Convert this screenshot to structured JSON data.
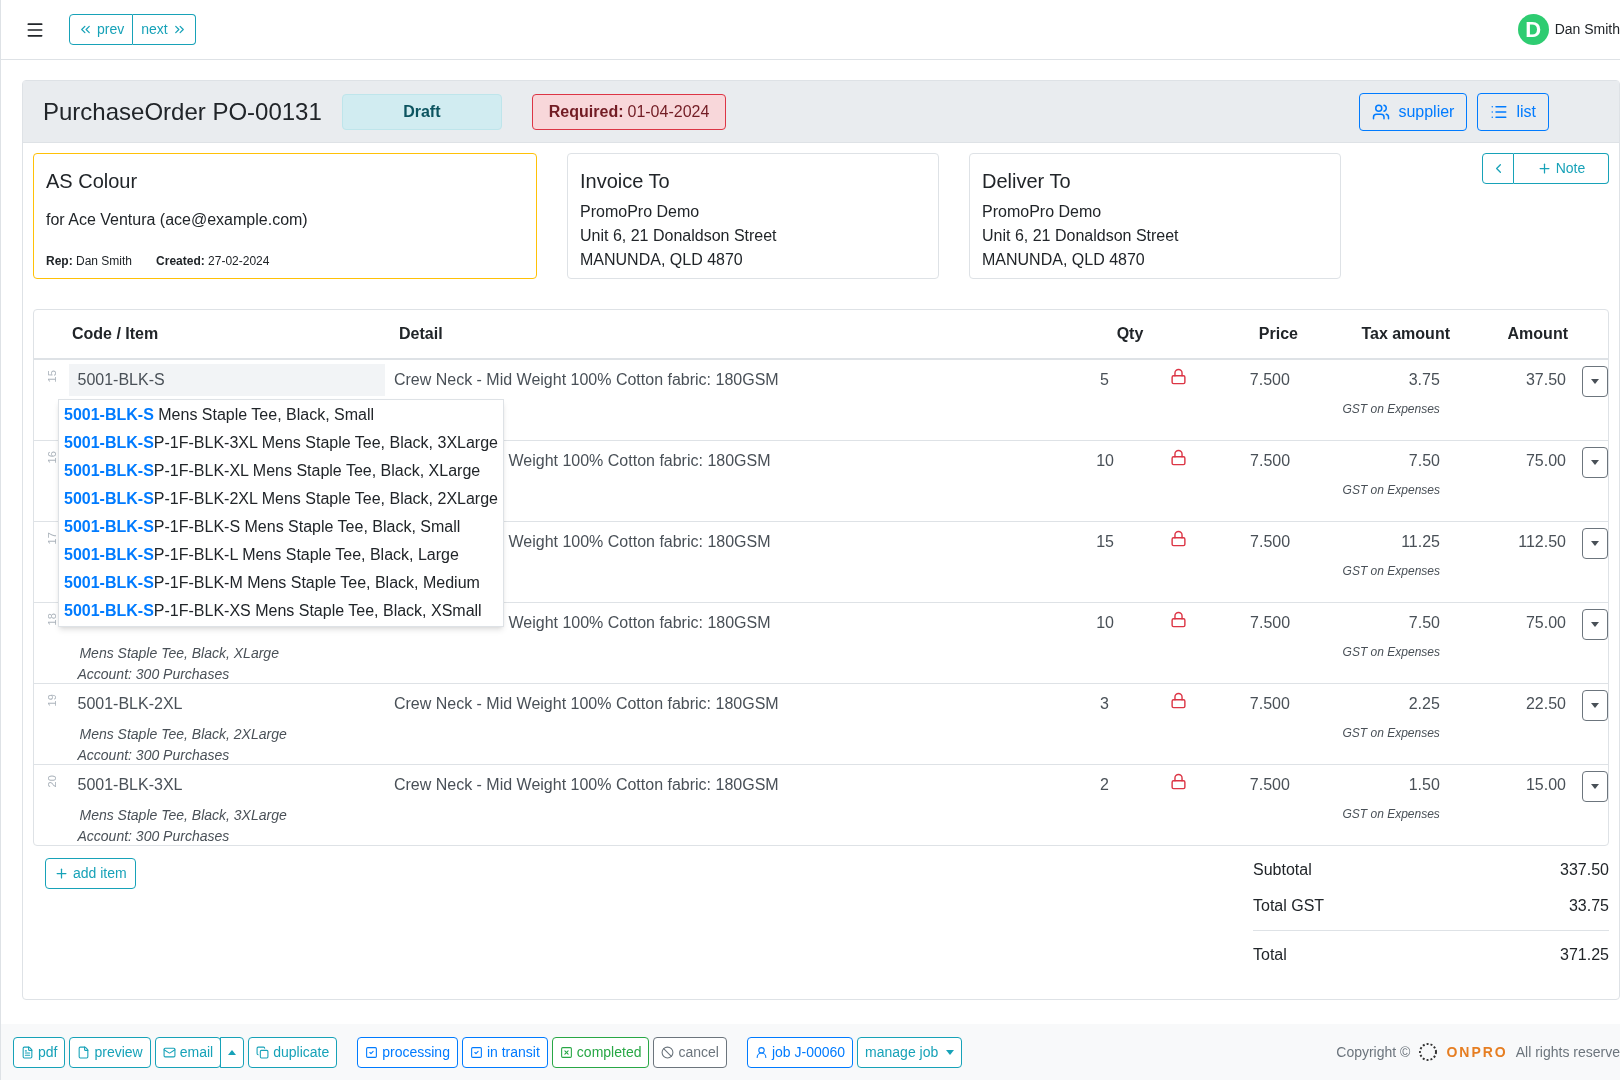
{
  "nav": {
    "prev": "prev",
    "next": "next",
    "user": {
      "initial": "D",
      "name": "Dan Smith"
    }
  },
  "order": {
    "title": "PurchaseOrder PO-00131",
    "status": "Draft",
    "required_label": "Required:",
    "required_date": "01-04-2024",
    "supplier_button": "supplier",
    "list_button": "list",
    "note_button": "Note"
  },
  "supplier": {
    "name": "AS Colour",
    "for": "for Ace Ventura (ace@example.com)",
    "rep_label": "Rep:",
    "rep": "Dan Smith",
    "created_label": "Created:",
    "created": "27-02-2024"
  },
  "addresses": [
    {
      "title": "Invoice To",
      "lines": [
        "PromoPro Demo",
        "Unit 6, 21 Donaldson Street",
        "MANUNDA, QLD 4870"
      ]
    },
    {
      "title": "Deliver To",
      "lines": [
        "PromoPro Demo",
        "Unit 6, 21 Donaldson Street",
        "MANUNDA, QLD 4870"
      ]
    }
  ],
  "table": {
    "columns": [
      "Code / Item",
      "Detail",
      "Qty",
      "Price",
      "Tax amount",
      "Amount"
    ],
    "rows": [
      {
        "line": "15",
        "code": "5001-BLK-S",
        "editing": true,
        "detail": "Crew Neck - Mid Weight 100% Cotton fabric: 180GSM",
        "qty": "5",
        "locked": true,
        "price": "7.500",
        "tax": "3.75",
        "tax_type": "GST on Expenses",
        "amount": "37.50"
      },
      {
        "line": "16",
        "covered": true,
        "detail": "Weight 100% Cotton fabric: 180GSM",
        "qty": "10",
        "locked": true,
        "price": "7.500",
        "tax": "7.50",
        "tax_type": "GST on Expenses",
        "amount": "75.00"
      },
      {
        "line": "17",
        "covered": true,
        "detail": "Weight 100% Cotton fabric: 180GSM",
        "qty": "15",
        "locked": true,
        "price": "7.500",
        "tax": "11.25",
        "tax_type": "GST on Expenses",
        "amount": "112.50"
      },
      {
        "line": "18",
        "covered": true,
        "detail": "Weight 100% Cotton fabric: 180GSM",
        "description": "Mens Staple Tee, Black, XLarge",
        "account": "Account: 300 Purchases",
        "qty": "10",
        "locked": true,
        "price": "7.500",
        "tax": "7.50",
        "tax_type": "GST on Expenses",
        "amount": "75.00"
      },
      {
        "line": "19",
        "code": "5001-BLK-2XL",
        "detail": "Crew Neck - Mid Weight 100% Cotton fabric: 180GSM",
        "description": "Mens Staple Tee, Black, 2XLarge",
        "account": "Account: 300 Purchases",
        "qty": "3",
        "locked": true,
        "price": "7.500",
        "tax": "2.25",
        "tax_type": "GST on Expenses",
        "amount": "22.50"
      },
      {
        "line": "20",
        "code": "5001-BLK-3XL",
        "detail": "Crew Neck - Mid Weight 100% Cotton fabric: 180GSM",
        "description": "Mens Staple Tee, Black, 3XLarge",
        "account": "Account: 300 Purchases",
        "qty": "2",
        "locked": true,
        "price": "7.500",
        "tax": "1.50",
        "tax_type": "GST on Expenses",
        "amount": "15.00"
      }
    ]
  },
  "suggestions": [
    {
      "match": "5001-BLK-S",
      "rest": " Mens Staple Tee, Black, Small"
    },
    {
      "match": "5001-BLK-S",
      "rest": "P-1F-BLK-3XL Mens Staple Tee, Black, 3XLarge"
    },
    {
      "match": "5001-BLK-S",
      "rest": "P-1F-BLK-XL Mens Staple Tee, Black, XLarge"
    },
    {
      "match": "5001-BLK-S",
      "rest": "P-1F-BLK-2XL Mens Staple Tee, Black, 2XLarge"
    },
    {
      "match": "5001-BLK-S",
      "rest": "P-1F-BLK-S Mens Staple Tee, Black, Small"
    },
    {
      "match": "5001-BLK-S",
      "rest": "P-1F-BLK-L Mens Staple Tee, Black, Large"
    },
    {
      "match": "5001-BLK-S",
      "rest": "P-1F-BLK-M Mens Staple Tee, Black, Medium"
    },
    {
      "match": "5001-BLK-S",
      "rest": "P-1F-BLK-XS Mens Staple Tee, Black, XSmall"
    }
  ],
  "add_item": "add item",
  "totals": [
    {
      "label": "Subtotal",
      "value": "337.50"
    },
    {
      "label": "Total GST",
      "value": "33.75"
    },
    {
      "label": "Total",
      "value": "371.25"
    }
  ],
  "footer": {
    "buttons": [
      {
        "label": "pdf",
        "kind": "info"
      },
      {
        "label": "preview",
        "kind": "info"
      },
      {
        "label": "email",
        "kind": "info"
      },
      {
        "label": "duplicate",
        "kind": "info"
      },
      {
        "label": "processing",
        "kind": "primary"
      },
      {
        "label": "in transit",
        "kind": "primary"
      },
      {
        "label": "completed",
        "kind": "success"
      },
      {
        "label": "cancel",
        "kind": "secondary"
      },
      {
        "label": "job J-00060",
        "kind": "primary"
      },
      {
        "label": "manage job",
        "kind": "info"
      }
    ],
    "copyright": "Copyright ©",
    "brand": "ONPRO",
    "rights": "All rights reserve"
  }
}
